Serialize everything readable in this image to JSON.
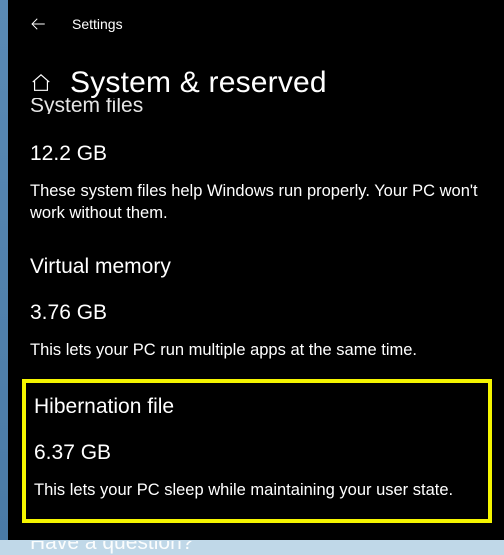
{
  "titlebar": {
    "label": "Settings"
  },
  "header": {
    "title": "System & reserved"
  },
  "sections": {
    "system_files": {
      "heading_partial": "System files",
      "size": "12.2 GB",
      "desc": "These system files help Windows run properly. Your PC won't work without them."
    },
    "virtual_memory": {
      "heading": "Virtual memory",
      "size": "3.76 GB",
      "desc": "This lets your PC run multiple apps at the same time."
    },
    "hibernation": {
      "heading": "Hibernation file",
      "size": "6.37 GB",
      "desc": "This lets your PC sleep while maintaining your user state."
    },
    "bottom_partial": "Have a question?"
  },
  "highlight_color": "#f5f500"
}
